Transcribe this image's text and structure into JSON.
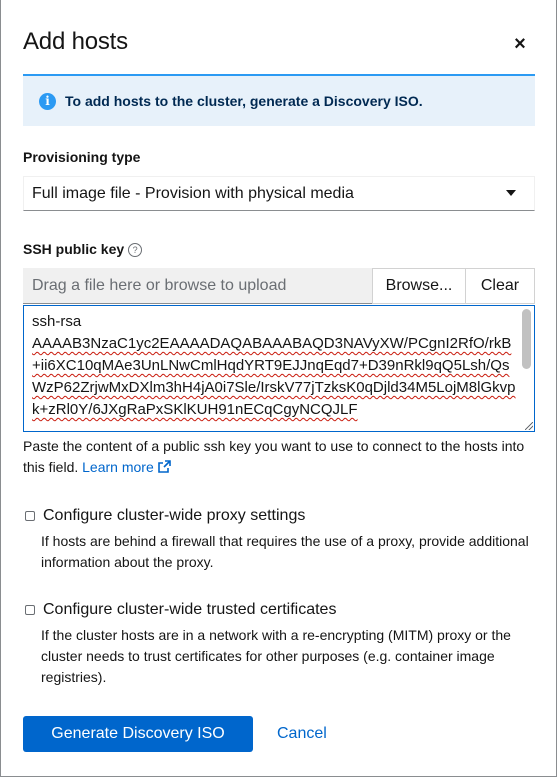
{
  "modal": {
    "title": "Add hosts",
    "close_icon": "×"
  },
  "alert": {
    "icon": "info-icon",
    "text": "To add hosts to the cluster, generate a Discovery ISO."
  },
  "provisioning": {
    "label": "Provisioning type",
    "selected": "Full image file - Provision with physical media"
  },
  "ssh": {
    "label": "SSH public key",
    "help_icon": "?",
    "upload_placeholder": "Drag a file here or browse to upload",
    "browse_label": "Browse...",
    "clear_label": "Clear",
    "key_prefix": "ssh-rsa",
    "key_body": "AAAAB3NzaC1yc2EAAAADAQABAAABAQD3NAVyXW/PCgnI2RfO/rkB+ii6XC10qMAe3UnLNwCmlHqdYRT9EJJnqEqd7+D39nRkl9qQ5Lsh/QsWzP62ZrjwMxDXlm3hH4jA0i7Sle/IrskV77jTzksK0qDjld34M5LojM8lGkvpk+zRl0Y/6JXgRaPxSKlKUH91nECqCgyNCQJLF",
    "helper_text": "Paste the content of a public ssh key you want to use to connect to the hosts into this field.",
    "learn_more": "Learn more"
  },
  "proxy": {
    "label": "Configure cluster-wide proxy settings",
    "description": "If hosts are behind a firewall that requires the use of a proxy, provide additional information about the proxy."
  },
  "certs": {
    "label": "Configure cluster-wide trusted certificates",
    "description": "If the cluster hosts are in a network with a re-encrypting (MITM) proxy or the cluster needs to trust certificates for other purposes (e.g. container image registries)."
  },
  "actions": {
    "primary": "Generate Discovery ISO",
    "cancel": "Cancel"
  },
  "colors": {
    "primary": "#0066cc",
    "alert_bg": "#e7f1fa",
    "info": "#2b9af3"
  }
}
